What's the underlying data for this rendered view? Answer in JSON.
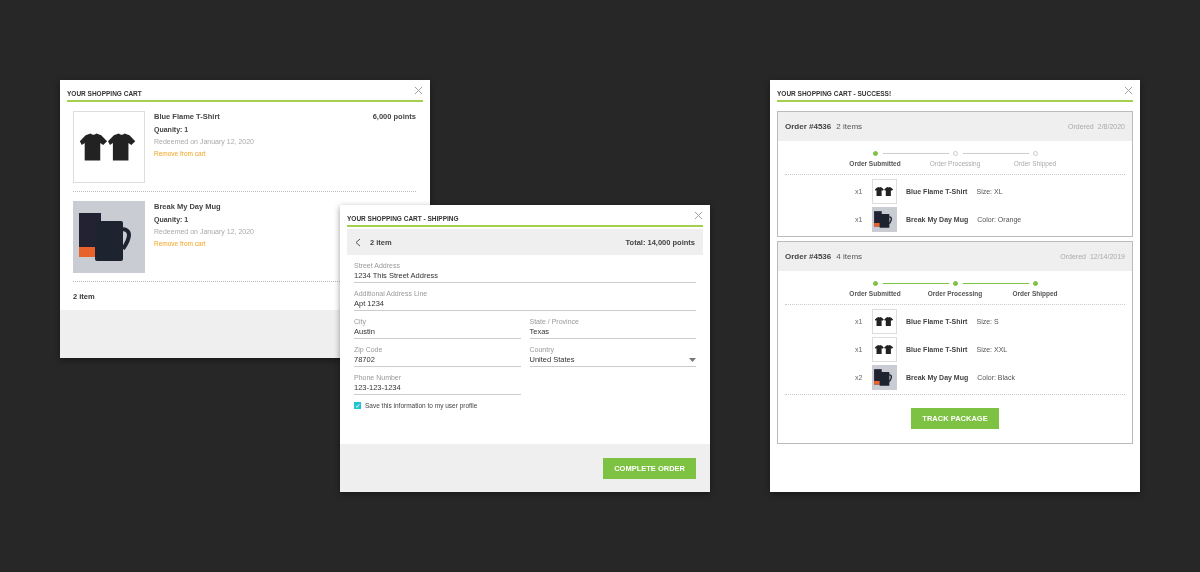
{
  "cart": {
    "title": "YOUR SHOPPING CART",
    "items": [
      {
        "kind": "tshirt",
        "name": "Blue Flame T-Shirt",
        "points": "6,000 points",
        "quantity": "Quanity: 1",
        "redeemed": "Redeemed on January 12, 2020",
        "remove": "Remove from cart"
      },
      {
        "kind": "mug",
        "name": "Break My Day Mug",
        "quantity": "Quanity: 1",
        "redeemed": "Redeemed on January 12, 2020",
        "remove": "Remove from cart"
      }
    ],
    "count": "2 item"
  },
  "shipping": {
    "title": "YOUR SHOPPING CART - SHIPPING",
    "count": "2 item",
    "total": "Total: 14,000 points",
    "fields": [
      {
        "kind": "text",
        "wide": true,
        "label": "Street Address",
        "value": "1234 This Street Address"
      },
      {
        "kind": "text",
        "wide": true,
        "label": "Additional Address Line",
        "value": "Apt 1234"
      },
      {
        "kind": "text",
        "wide": false,
        "label": "City",
        "value": "Austin"
      },
      {
        "kind": "text",
        "wide": false,
        "label": "State / Province",
        "value": "Texas"
      },
      {
        "kind": "text",
        "wide": false,
        "label": "Zip Code",
        "value": "78702"
      },
      {
        "kind": "select",
        "wide": false,
        "label": "Country",
        "value": "United States"
      },
      {
        "kind": "text",
        "wide": false,
        "label": "Phone Number",
        "value": "123-123-1234"
      }
    ],
    "save": {
      "label": "Save this information to my user profile",
      "checked": true
    },
    "button": "COMPLETE ORDER"
  },
  "success": {
    "title": "YOUR SHOPPING CART - SUCCESS!",
    "orders": [
      {
        "number": "Order #4536",
        "count": "2 items",
        "ordered_label": "Ordered",
        "date": "2/8/2020",
        "steps": [
          {
            "label": "Order Submitted",
            "done": true
          },
          {
            "label": "Order Processing",
            "done": false
          },
          {
            "label": "Order Shipped",
            "done": false
          }
        ],
        "items": [
          {
            "kind": "tshirt",
            "qty": "x1",
            "name": "Blue Flame T-Shirt",
            "detail": "Size: XL"
          },
          {
            "kind": "mug",
            "qty": "x1",
            "name": "Break My Day Mug",
            "detail": "Color: Orange"
          }
        ]
      },
      {
        "number": "Order #4536",
        "count": "4 items",
        "ordered_label": "Ordered",
        "date": "12/14/2019",
        "steps": [
          {
            "label": "Order Submitted",
            "done": true
          },
          {
            "label": "Order Processing",
            "done": true
          },
          {
            "label": "Order Shipped",
            "done": true
          }
        ],
        "items": [
          {
            "kind": "tshirt",
            "qty": "x1",
            "name": "Blue Flame T-Shirt",
            "detail": "Size: S"
          },
          {
            "kind": "tshirt",
            "qty": "x1",
            "name": "Blue Flame T-Shirt",
            "detail": "Size: XXL"
          },
          {
            "kind": "mug",
            "qty": "x2",
            "name": "Break My Day Mug",
            "detail": "Color: Black"
          }
        ],
        "button": "TRACK PACKAGE"
      }
    ]
  }
}
